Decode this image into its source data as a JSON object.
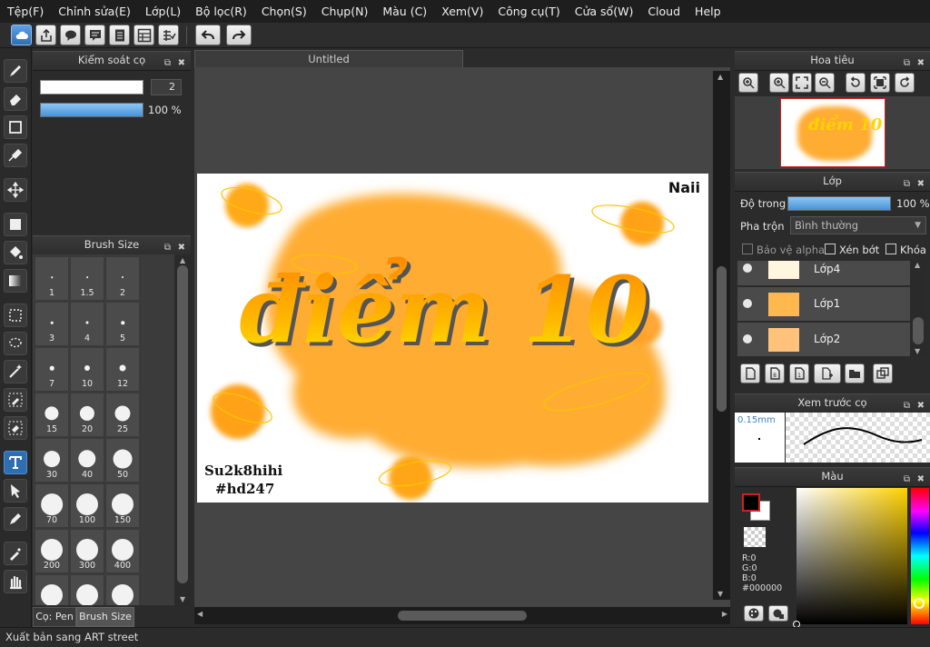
{
  "menu": [
    "Tệp(F)",
    "Chỉnh sửa(E)",
    "Lớp(L)",
    "Bộ lọc(R)",
    "Chọn(S)",
    "Chụp(N)",
    "Màu (C)",
    "Xem(V)",
    "Công cụ(T)",
    "Cửa sổ(W)",
    "Cloud",
    "Help"
  ],
  "brush_control": {
    "title": "Kiểm soát cọ",
    "size_value": "2",
    "opacity_value": "100 %",
    "opacity_fraction": 1.0
  },
  "brush_size": {
    "title": "Brush Size",
    "sizes": [
      "1",
      "1.5",
      "2",
      "3",
      "4",
      "5",
      "7",
      "10",
      "12",
      "15",
      "20",
      "25",
      "30",
      "40",
      "50",
      "70",
      "100",
      "150",
      "200",
      "300",
      "400",
      "",
      "",
      ""
    ],
    "tabs": [
      "Cọ: Pen",
      "Brush Size"
    ]
  },
  "document": {
    "tab_title": "Untitled",
    "artwork": {
      "title_text": "điểm 10",
      "corner_text": "Naii",
      "signature_line1": "Su2k8hihi",
      "signature_line2": "#hd247"
    }
  },
  "navigator": {
    "title": "Hoa tiêu"
  },
  "layers": {
    "title": "Lớp",
    "opacity_label": "Độ trong",
    "opacity_value": "100 %",
    "opacity_fraction": 1.0,
    "blend_label": "Pha trộn",
    "blend_value": "Bình thường",
    "protect_alpha": "Bảo vệ alpha",
    "clipping": "Xén bớt",
    "lock": "Khóa",
    "items": [
      {
        "name": "Lớp4"
      },
      {
        "name": "Lớp1"
      },
      {
        "name": "Lớp2"
      }
    ]
  },
  "brush_preview": {
    "title": "Xem trước cọ",
    "size_label": "0.15mm"
  },
  "color": {
    "title": "Màu",
    "r": "R:0",
    "g": "G:0",
    "b": "B:0",
    "hex": "#000000",
    "foreground": "#000000",
    "background": "#ffffff"
  },
  "status": {
    "text": "Xuất bản sang ART street"
  },
  "colors": {
    "accent": "#4a90d9",
    "art_orange": "#ffa51f",
    "art_yellow": "#ffd400"
  }
}
